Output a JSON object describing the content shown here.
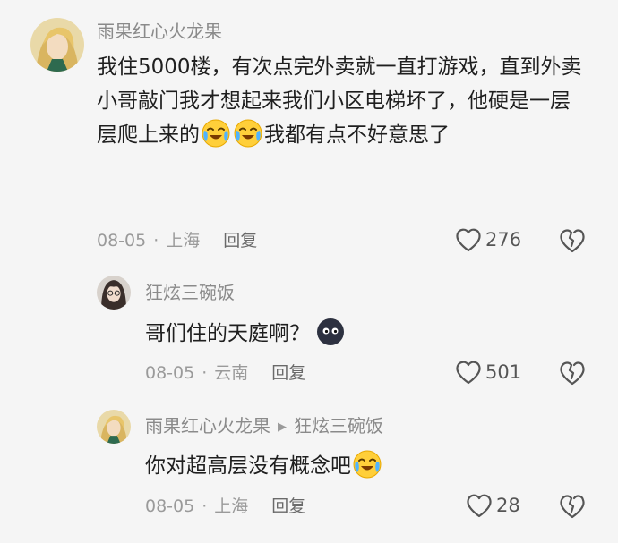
{
  "comments": [
    {
      "user": "雨果红心火龙果",
      "text_before": "我住5000楼，有次点完外卖就一直打游戏，直到外卖小哥敲门我才想起来我们小区电梯坏了，他硬是一层层爬上来的",
      "text_after": "我都有点不好意思了",
      "date": "08-05",
      "location": "上海",
      "reply": "回复",
      "likes": "276"
    },
    {
      "user": "狂炫三碗饭",
      "text_before": "哥们住的天庭啊？",
      "text_after": "",
      "date": "08-05",
      "location": "云南",
      "reply": "回复",
      "likes": "501"
    },
    {
      "user": "雨果红心火龙果",
      "reply_to": "狂炫三碗饭",
      "text_before": "你对超高层没有概念吧",
      "text_after": "",
      "date": "08-05",
      "location": "上海",
      "reply": "回复",
      "likes": "28"
    }
  ],
  "icons": {
    "like": "heart-outline-icon",
    "dislike": "broken-heart-icon",
    "emoji_cry": "crying-laughing-emoji",
    "emoji_dark": "dark-blob-emoji"
  }
}
